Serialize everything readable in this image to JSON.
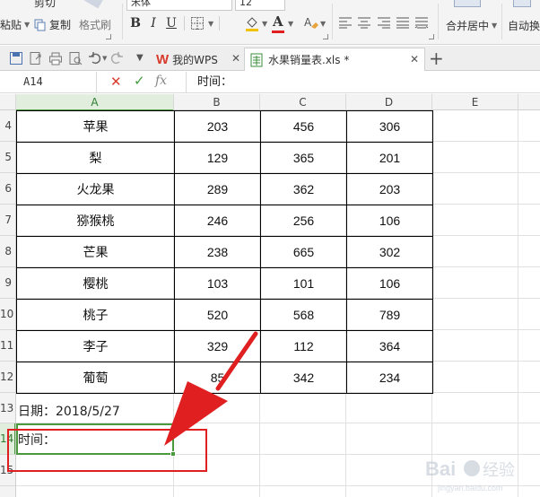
{
  "ribbon": {
    "cut_label": "剪切",
    "paste_label": "粘贴",
    "copy_label": "复制",
    "format_painter_label": "格式刷",
    "font_name": "宋体",
    "font_size": "12",
    "bold": "B",
    "italic": "I",
    "underline": "U",
    "merge_center_label": "合并居中",
    "auto_wrap_label": "自动换"
  },
  "tabs": [
    {
      "label": "我的WPS"
    },
    {
      "label": "水果销量表.xls *"
    }
  ],
  "formula_bar": {
    "name_box": "A14",
    "fx": "fx",
    "content": "时间："
  },
  "columns": [
    "A",
    "B",
    "C",
    "D",
    "E"
  ],
  "rows": [
    "4",
    "5",
    "6",
    "7",
    "8",
    "9",
    "10",
    "11",
    "12",
    "13",
    "14",
    "15"
  ],
  "data_rows": [
    {
      "name": "苹果",
      "b": "203",
      "c": "456",
      "d": "306"
    },
    {
      "name": "梨",
      "b": "129",
      "c": "365",
      "d": "201"
    },
    {
      "name": "火龙果",
      "b": "289",
      "c": "362",
      "d": "203"
    },
    {
      "name": "猕猴桃",
      "b": "246",
      "c": "256",
      "d": "106"
    },
    {
      "name": "芒果",
      "b": "238",
      "c": "665",
      "d": "302"
    },
    {
      "name": "樱桃",
      "b": "103",
      "c": "101",
      "d": "106"
    },
    {
      "name": "桃子",
      "b": "520",
      "c": "568",
      "d": "789"
    },
    {
      "name": "李子",
      "b": "329",
      "c": "112",
      "d": "364"
    },
    {
      "name": "葡萄",
      "b": "85",
      "c": "342",
      "d": "234"
    }
  ],
  "cells": {
    "a13": "日期：2018/5/27",
    "a14": "时间："
  },
  "colors": {
    "accent_green": "#4a9a3d",
    "annotation_red": "#e02020",
    "wps_red": "#d83b2c"
  },
  "watermark_text": "Baidu经验"
}
